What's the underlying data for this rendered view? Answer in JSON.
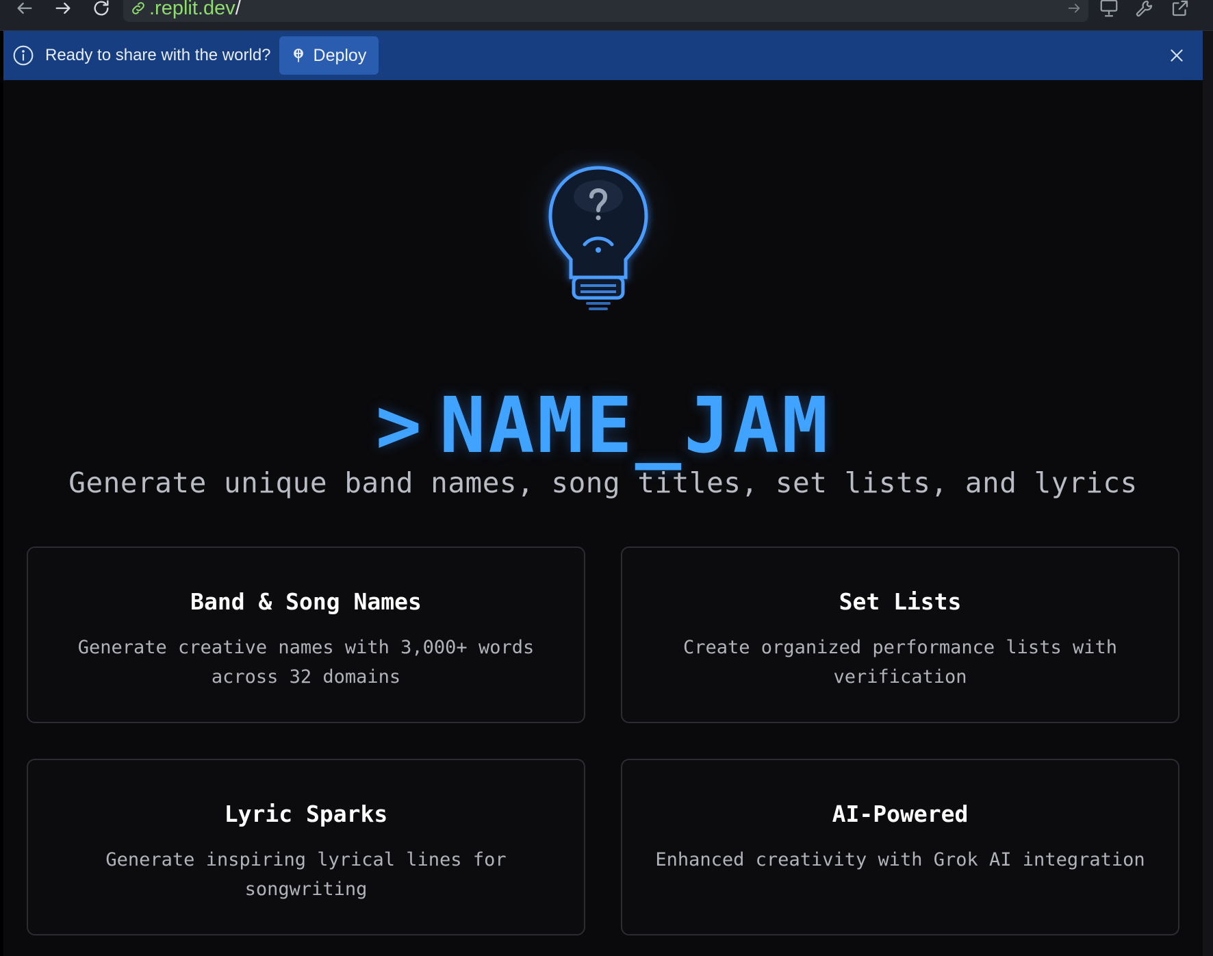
{
  "browser": {
    "url_host": ".replit.dev",
    "url_path": "/",
    "icons": [
      "back-arrow-icon",
      "forward-arrow-icon",
      "reload-icon",
      "link-icon",
      "go-arrow-icon",
      "devices-icon",
      "wrench-icon",
      "external-link-icon"
    ]
  },
  "banner": {
    "message": "Ready to share with the world?",
    "deploy_label": "Deploy",
    "background": "#163e80",
    "button_color": "#2a5cb0"
  },
  "app": {
    "title_prompt": ">",
    "title": "NAME_JAM",
    "subtitle": "Generate unique band names, song titles, set lists, and lyrics",
    "accent": "#3fa3ff",
    "background": "#0a0a0c"
  },
  "features": [
    {
      "title": "Band & Song Names",
      "description": "Generate creative names with 3,000+ words across 32 domains"
    },
    {
      "title": "Set Lists",
      "description": "Create organized performance lists with verification"
    },
    {
      "title": "Lyric Sparks",
      "description": "Generate inspiring lyrical lines for songwriting"
    },
    {
      "title": "AI-Powered",
      "description": "Enhanced creativity with Grok AI integration"
    }
  ]
}
